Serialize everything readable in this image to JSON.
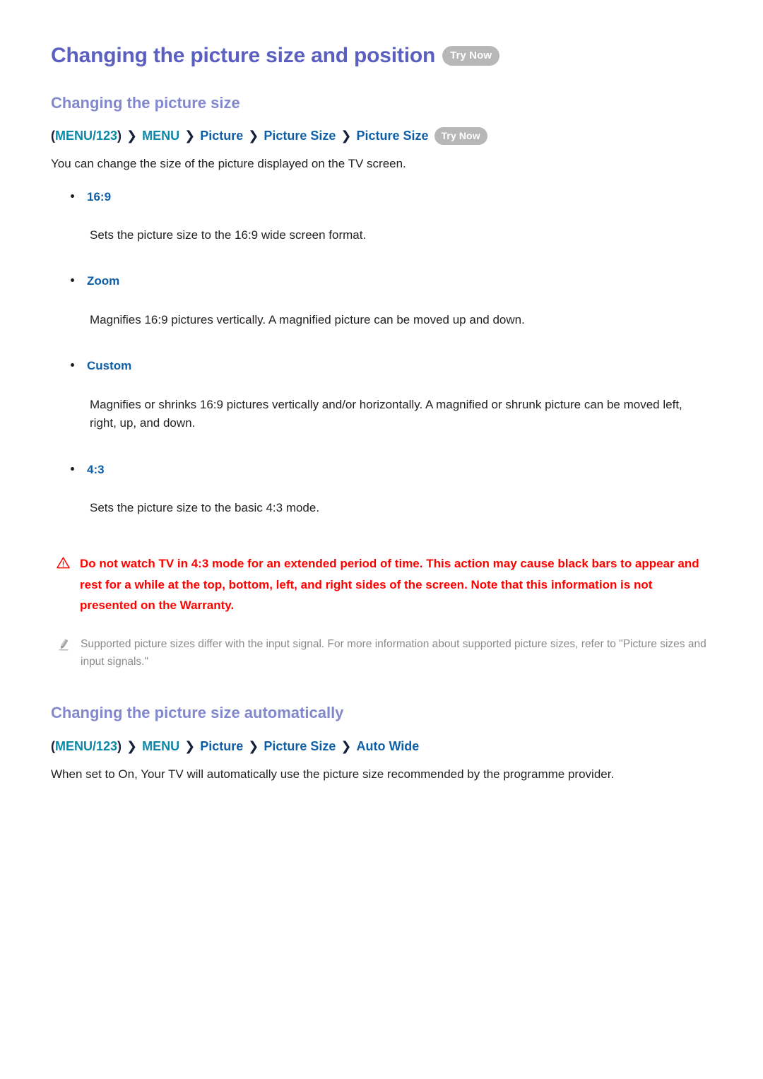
{
  "title": {
    "text": "Changing the picture size and position",
    "badge": "Try Now"
  },
  "section1": {
    "heading": "Changing the picture size",
    "breadcrumb": {
      "open_paren": "(",
      "menu123": "MENU/123",
      "close_paren": ")",
      "separator": "❯",
      "items": [
        "MENU",
        "Picture",
        "Picture Size",
        "Picture Size"
      ],
      "badge": "Try Now"
    },
    "intro": "You can change the size of the picture displayed on the TV screen.",
    "options": [
      {
        "label": "16:9",
        "description": "Sets the picture size to the 16:9 wide screen format."
      },
      {
        "label": "Zoom",
        "description": "Magnifies 16:9 pictures vertically. A magnified picture can be moved up and down."
      },
      {
        "label": "Custom",
        "description": "Magnifies or shrinks 16:9 pictures vertically and/or horizontally. A magnified or shrunk picture can be moved left, right, up, and down."
      },
      {
        "label": "4:3",
        "description": "Sets the picture size to the basic 4:3 mode."
      }
    ],
    "warning": {
      "icon": "warning-triangle-icon",
      "text": "Do not watch TV in 4:3 mode for an extended period of time. This action may cause black bars to appear and rest for a while at the top, bottom, left, and right sides of the screen. Note that this information is not presented on the Warranty."
    },
    "note": {
      "icon": "pencil-icon",
      "text": "Supported picture sizes differ with the input signal. For more information about supported picture sizes, refer to \"Picture sizes and input signals.\""
    }
  },
  "section2": {
    "heading": "Changing the picture size automatically",
    "breadcrumb": {
      "open_paren": "(",
      "menu123": "MENU/123",
      "close_paren": ")",
      "separator": "❯",
      "items": [
        "MENU",
        "Picture",
        "Picture Size",
        "Auto Wide"
      ]
    },
    "body": "When set to On, Your TV will automatically use the picture size recommended by the programme provider."
  },
  "colors": {
    "title_purple": "#5a5fc0",
    "heading_purple": "#8288cd",
    "link_blue": "#0f5fa8",
    "link_teal": "#0d87a8",
    "warning_red": "#fe0000",
    "note_gray": "#8a8a8a",
    "badge_gray": "#b7b7b7",
    "body_black": "#231f20"
  }
}
